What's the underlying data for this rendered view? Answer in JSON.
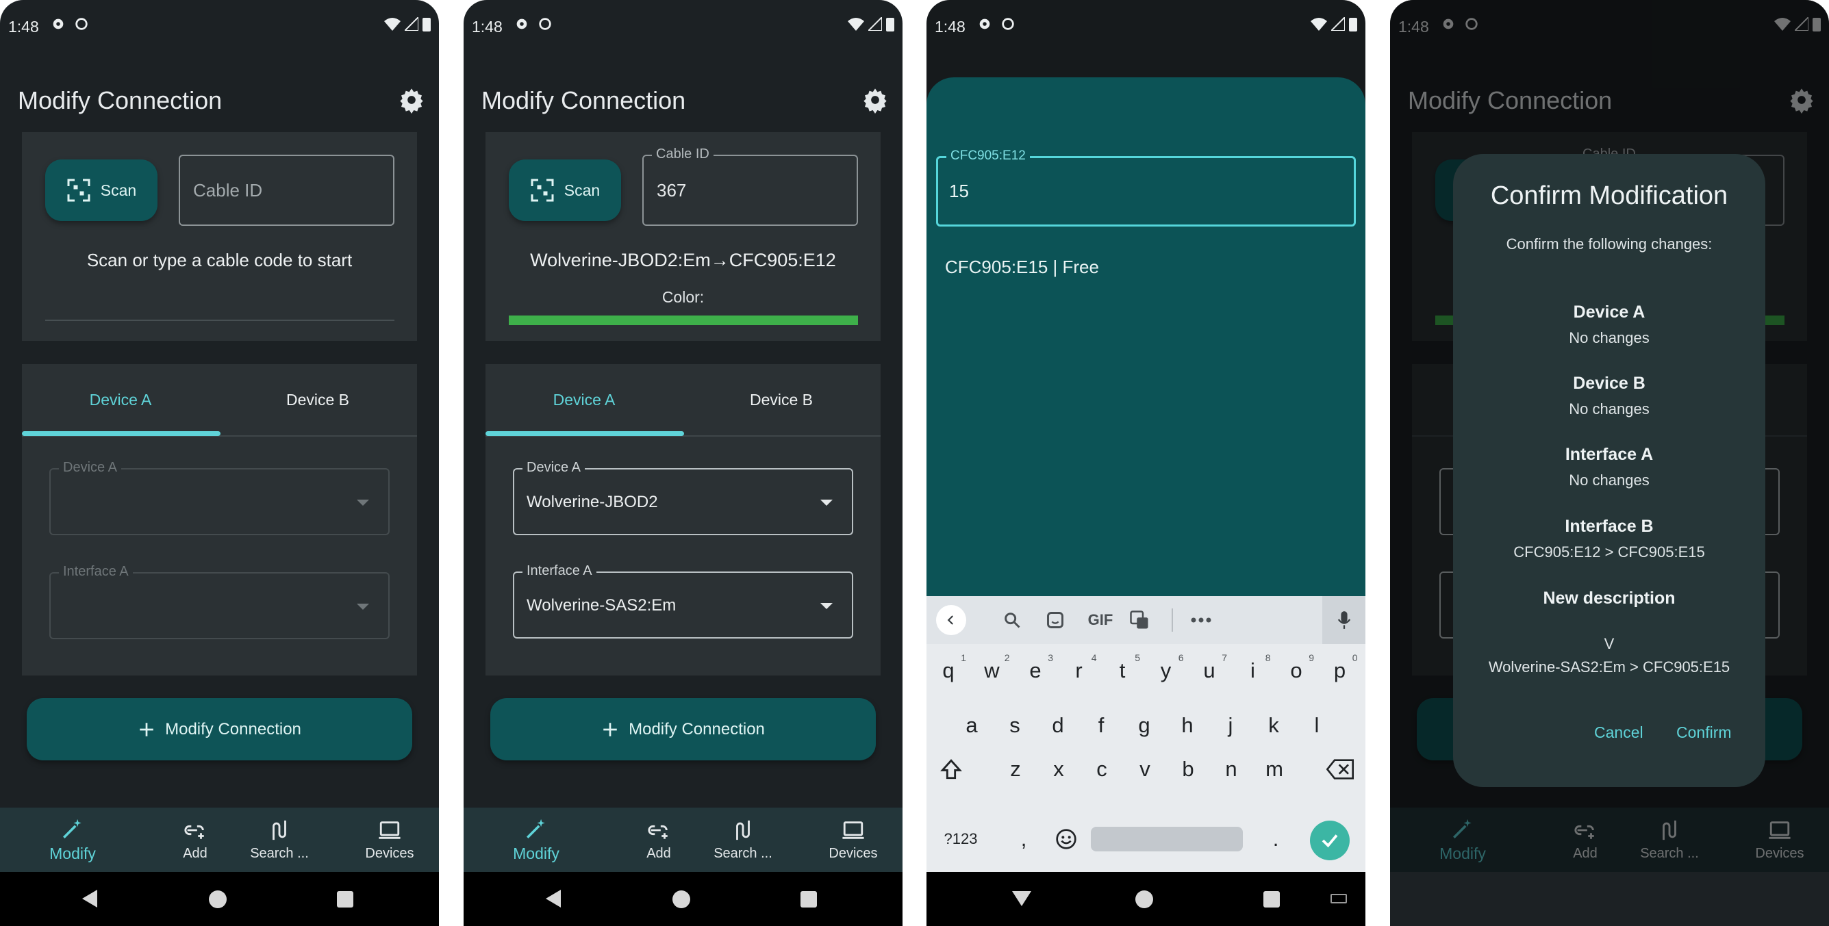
{
  "status_bar": {
    "time": "1:48"
  },
  "app": {
    "title": "Modify Connection"
  },
  "scan": {
    "label": "Scan"
  },
  "cable_field": {
    "placeholder": "Cable ID",
    "label": "Cable ID",
    "value": "367"
  },
  "hint": "Scan or type a cable code to start",
  "connection": {
    "summary": "Wolverine-JBOD2:Em→CFC905:E12",
    "color_label": "Color:",
    "color": "#3eb04a"
  },
  "tabs": {
    "device_a": "Device A",
    "device_b": "Device B"
  },
  "fields": {
    "device_a_label": "Device A",
    "interface_a_label": "Interface A",
    "device_a_value": "Wolverine-JBOD2",
    "interface_a_value": "Wolverine-SAS2:Em"
  },
  "modify_button": {
    "label": "Modify Connection"
  },
  "bottom_nav": [
    {
      "label": "Modify",
      "icon": "magic-wand-icon"
    },
    {
      "label": "Add",
      "icon": "add-link-icon"
    },
    {
      "label": "Search ...",
      "icon": "cable-search-icon"
    },
    {
      "label": "Devices",
      "icon": "devices-icon"
    }
  ],
  "interface_edit": {
    "label": "CFC905:E12",
    "value": "15",
    "suggestion": "CFC905:E15 | Free"
  },
  "keyboard": {
    "row1": [
      {
        "k": "q",
        "n": "1"
      },
      {
        "k": "w",
        "n": "2"
      },
      {
        "k": "e",
        "n": "3"
      },
      {
        "k": "r",
        "n": "4"
      },
      {
        "k": "t",
        "n": "5"
      },
      {
        "k": "y",
        "n": "6"
      },
      {
        "k": "u",
        "n": "7"
      },
      {
        "k": "i",
        "n": "8"
      },
      {
        "k": "o",
        "n": "9"
      },
      {
        "k": "p",
        "n": "0"
      }
    ],
    "row2": [
      "a",
      "s",
      "d",
      "f",
      "g",
      "h",
      "j",
      "k",
      "l"
    ],
    "row3": [
      "z",
      "x",
      "c",
      "v",
      "b",
      "n",
      "m"
    ],
    "symbols": "?123",
    "comma": ",",
    "period": ".",
    "gif": "GIF"
  },
  "dialog": {
    "title": "Confirm Modification",
    "subtitle": "Confirm the following changes:",
    "items": [
      {
        "head": "Device A",
        "value": "No changes"
      },
      {
        "head": "Device B",
        "value": "No changes"
      },
      {
        "head": "Interface A",
        "value": "No changes"
      },
      {
        "head": "Interface B",
        "value": "CFC905:E12 > CFC905:E15"
      },
      {
        "head": "New description",
        "value": "V"
      }
    ],
    "description_value": "Wolverine-SAS2:Em > CFC905:E15",
    "cancel": "Cancel",
    "confirm": "Confirm"
  },
  "colors": {
    "accent": "#5fd3d8",
    "primary_button": "#0e5457",
    "surface": "#2b3134",
    "background": "#1c2124",
    "keyboard_check": "#3cb6a4"
  }
}
